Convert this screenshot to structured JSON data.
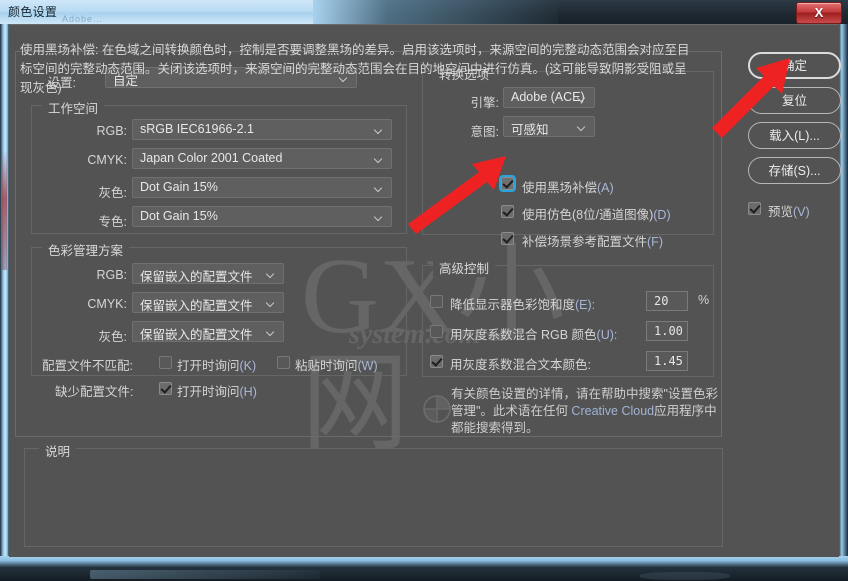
{
  "window": {
    "title": "颜色设置",
    "title_ghost": "Adobe…",
    "close_label": "X"
  },
  "settings_row": {
    "label": "设置:",
    "value": "自定"
  },
  "working_spaces": {
    "title": "工作空间",
    "rows": [
      {
        "label": "RGB:",
        "value": "sRGB IEC61966-2.1"
      },
      {
        "label": "CMYK:",
        "value": "Japan Color 2001 Coated"
      },
      {
        "label": "灰色:",
        "value": "Dot Gain 15%"
      },
      {
        "label": "专色:",
        "value": "Dot Gain 15%"
      }
    ]
  },
  "color_management": {
    "title": "色彩管理方案",
    "rows": [
      {
        "label": "RGB:",
        "value": "保留嵌入的配置文件"
      },
      {
        "label": "CMYK:",
        "value": "保留嵌入的配置文件"
      },
      {
        "label": "灰色:",
        "value": "保留嵌入的配置文件"
      }
    ],
    "mismatch_label": "配置文件不匹配:",
    "mismatch_open": {
      "text": "打开时询问",
      "accel": "(K)",
      "checked": false
    },
    "mismatch_paste": {
      "text": "粘贴时询问",
      "accel": "(W)",
      "checked": false
    },
    "missing_label": "缺少配置文件:",
    "missing_open": {
      "text": "打开时询问",
      "accel": "(H)",
      "checked": true
    }
  },
  "conversion": {
    "title": "转换选项",
    "engine_label": "引擎:",
    "engine_value": "Adobe (ACE)",
    "intent_label": "意图:",
    "intent_value": "可感知",
    "options": [
      {
        "text": "使用黑场补偿",
        "accel": "(A)",
        "checked": true,
        "focused": true
      },
      {
        "text": "使用仿色(8位/通道图像)",
        "accel": "(D)",
        "checked": true,
        "focused": false
      },
      {
        "text": "补偿场景参考配置文件",
        "accel": "(F)",
        "checked": true,
        "focused": false
      }
    ]
  },
  "advanced": {
    "title": "高级控制",
    "rows": [
      {
        "text": "降低显示器色彩饱和度",
        "accel": "(E):",
        "checked": false,
        "value": "20",
        "suffix": "%"
      },
      {
        "text": "用灰度系数混合 RGB 颜色",
        "accel": "(U):",
        "checked": false,
        "value": "1.00",
        "suffix": ""
      },
      {
        "text": "用灰度系数混合文本颜色:",
        "accel": "",
        "checked": true,
        "value": "1.45",
        "suffix": ""
      }
    ]
  },
  "help_note": {
    "line1": "有关颜色设置的详情，请在帮助中搜索\"设",
    "line2_a": "置色彩管理\"。此术语在任何 ",
    "line2_cc": "Creative Cloud",
    "line3": "应用程序中都能搜索得到。"
  },
  "description": {
    "title": "说明",
    "text": "使用黑场补偿: 在色域之间转换颜色时，控制是否要调整黑场的差异。启用该选项时，来源空间的完整动态范围会对应至目标空间的完整动态范围。关闭该选项时，来源空间的完整动态范围会在目的地空间中进行仿真。(这可能导致阴影受阻或呈现灰色)"
  },
  "buttons": [
    {
      "label": "确定",
      "primary": true
    },
    {
      "label": "复位",
      "primary": false
    },
    {
      "label": "载入(L)...",
      "primary": false
    },
    {
      "label": "存储(S)...",
      "primary": false
    }
  ],
  "preview": {
    "text": "预览",
    "accel": "(V)",
    "checked": true
  },
  "watermark": {
    "main": "GX小网",
    "sub": "system.com"
  },
  "colors": {
    "dialog_bg": "#535353",
    "accent_blue": "#29a3e0",
    "arrow_red": "#ee2222",
    "accel_text": "#a8b7d8"
  }
}
